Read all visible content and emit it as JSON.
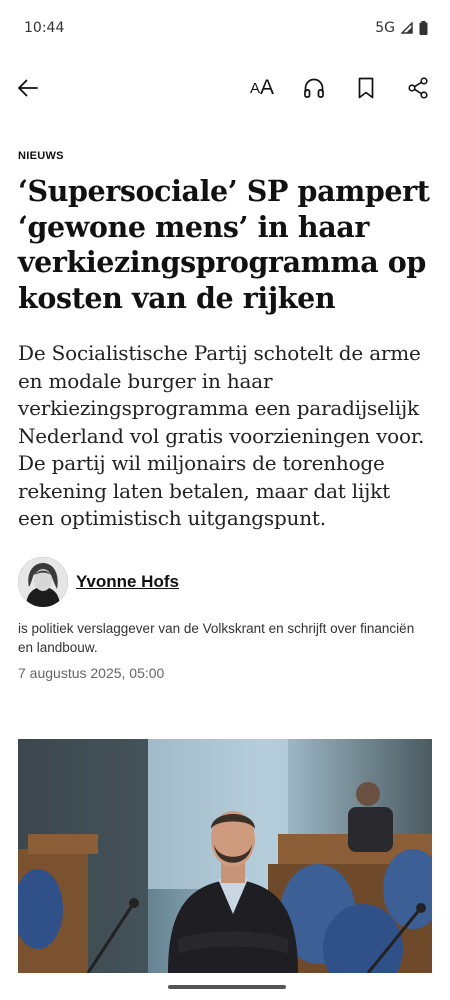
{
  "status_bar": {
    "time": "10:44",
    "network": "5G"
  },
  "toolbar": {
    "back_icon": "arrow-left-icon",
    "font_size_small": "A",
    "font_size_large": "A",
    "listen_icon": "headphones-icon",
    "bookmark_icon": "bookmark-icon",
    "share_icon": "share-icon"
  },
  "article": {
    "section": "NIEUWS",
    "headline": "‘Supersociale’ SP pampert ‘gewone mens’ in haar verkiezingsprogramma op kosten van de rijken",
    "intro": "De Socialistische Partij schotelt de arme en modale burger in haar verkiezingsprogramma een paradijselijk Nederland vol gratis voorzieningen voor. De partij wil miljonairs de torenhoge rekening laten betalen, maar dat lijkt een optimistisch uitgangspunt.",
    "author": {
      "name": "Yvonne Hofs",
      "bio": "is politiek verslaggever van de Volkskrant en schrijft over financiën en landbouw."
    },
    "date": "7 augustus 2025, 05:00"
  },
  "colors": {
    "text": "#111111",
    "muted": "#666666",
    "background": "#ffffff"
  }
}
